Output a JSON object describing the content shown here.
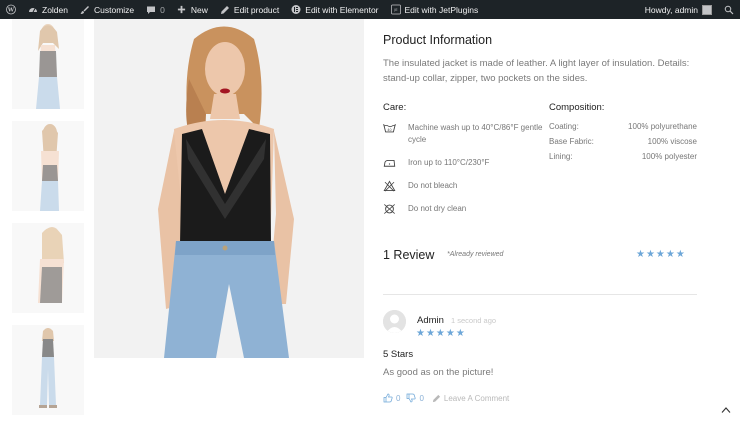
{
  "adminbar": {
    "wp_logo_icon": "wordpress-icon",
    "site_name": "Zolden",
    "customize": "Customize",
    "comments_count": "0",
    "new": "New",
    "edit_product": "Edit product",
    "edit_elementor": "Edit with Elementor",
    "edit_jetplugins": "Edit with JetPlugins",
    "howdy": "Howdy, admin"
  },
  "product": {
    "title": "Product Information",
    "description": "The insulated jacket is made of leather. A light layer of insulation. Details: stand-up collar, zipper, two pockets on the sides.",
    "care_heading": "Care:",
    "care_items": [
      {
        "icon": "wash-icon",
        "text": "Machine wash up to 40°C/86°F gentle cycle"
      },
      {
        "icon": "iron-icon",
        "text": "Iron up to 110°C/230°F"
      },
      {
        "icon": "no-bleach-icon",
        "text": "Do not bleach"
      },
      {
        "icon": "no-dry-clean-icon",
        "text": "Do not dry clean"
      }
    ],
    "composition_heading": "Composition:",
    "composition": [
      {
        "label": "Coating:",
        "value": "100% polyurethane"
      },
      {
        "label": "Base Fabric:",
        "value": "100% viscose"
      },
      {
        "label": "Lining:",
        "value": "100% polyester"
      }
    ]
  },
  "reviews": {
    "heading": "1 Review",
    "already_reviewed": "*Already reviewed",
    "average_stars": "★★★★★",
    "items": [
      {
        "author": "Admin",
        "time": "1 second ago",
        "stars": "★★★★★",
        "title": "5 Stars",
        "body": "As good as on the picture!",
        "likes": "0",
        "dislikes": "0",
        "leave_comment": "Leave A Comment"
      }
    ]
  },
  "colors": {
    "adminbar": "#1d2327",
    "star": "#6ea7d8",
    "denim": "#8fb2d4",
    "lace": "#1b1b1b"
  }
}
